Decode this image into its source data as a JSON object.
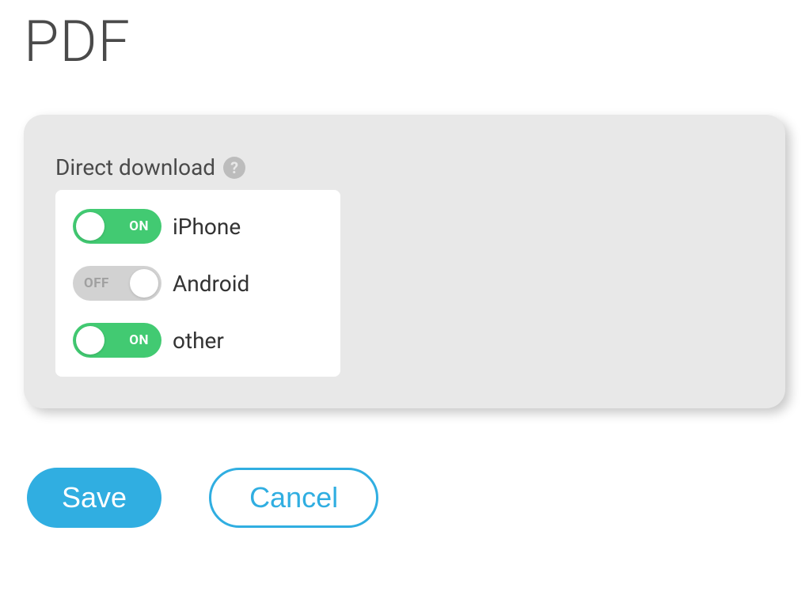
{
  "page": {
    "title": "PDF"
  },
  "section": {
    "label": "Direct download"
  },
  "toggles": {
    "on_text": "ON",
    "off_text": "OFF",
    "items": [
      {
        "label": "iPhone",
        "state": "on"
      },
      {
        "label": "Android",
        "state": "off"
      },
      {
        "label": "other",
        "state": "on"
      }
    ]
  },
  "buttons": {
    "save": "Save",
    "cancel": "Cancel"
  }
}
